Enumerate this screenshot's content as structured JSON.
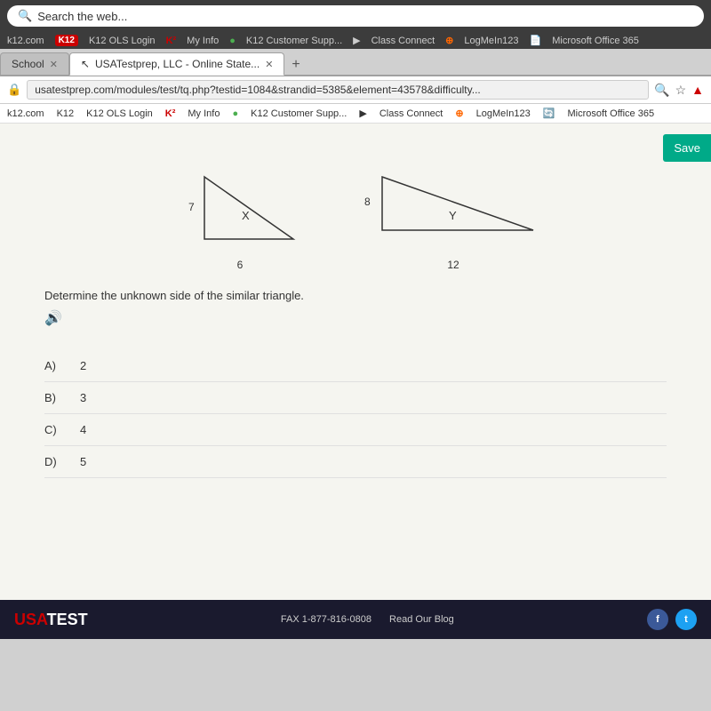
{
  "browser": {
    "search_placeholder": "Search the web...",
    "nav_items": [
      "k12.com",
      "K12 OLS Login",
      "My Info",
      "K12 Customer Supp...",
      "Class Connect",
      "LogMeIn123",
      "Microsoft Office 365"
    ],
    "tab1_label": "School",
    "tab2_label": "USATestprep, LLC - Online State...",
    "address_url": "usatestprep.com/modules/test/tq.php?testid=1084&strandid=5385&element=43578&difficulty...",
    "nav2_items": [
      "k12.com",
      "K12 OLS Login",
      "My Info",
      "K12 Customer Supp...",
      "Class Connect",
      "LogMeIn123",
      "Microsoft Office 365"
    ]
  },
  "page": {
    "save_button": "Save",
    "question": "Determine the unknown side of the similar triangle.",
    "triangle1": {
      "label_top": "7",
      "label_middle": "X",
      "label_bottom": "6"
    },
    "triangle2": {
      "label_top": "8",
      "label_middle": "Y",
      "label_bottom": "12"
    },
    "answers": [
      {
        "label": "A)",
        "value": "2"
      },
      {
        "label": "B)",
        "value": "3"
      },
      {
        "label": "C)",
        "value": "4"
      },
      {
        "label": "D)",
        "value": "5"
      }
    ]
  },
  "footer": {
    "brand_prefix": "USA",
    "brand_suffix": "TEST",
    "fax_label": "FAX 1-877-816-0808",
    "blog_label": "Read Our Blog"
  }
}
